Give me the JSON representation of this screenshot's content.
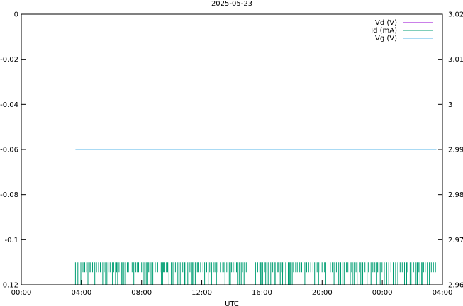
{
  "chart_data": {
    "type": "line",
    "title": "2025-05-23",
    "xlabel": "UTC",
    "ylabel": "",
    "y2label": "",
    "x_unit": "hours since 00:00 UTC",
    "xlim": [
      0,
      28
    ],
    "ylim": [
      -0.12,
      0
    ],
    "y2lim": [
      2.96,
      3.02
    ],
    "x_ticks": [
      0,
      4,
      8,
      12,
      16,
      20,
      24,
      28
    ],
    "x_tick_labels": [
      "00:00",
      "04:00",
      "08:00",
      "12:00",
      "16:00",
      "20:00",
      "00:00",
      "04:00"
    ],
    "y_ticks": [
      0,
      -0.02,
      -0.04,
      -0.06,
      -0.08,
      -0.1,
      -0.12
    ],
    "y_tick_labels": [
      "0",
      "-0.02",
      "-0.04",
      "-0.06",
      "-0.08",
      "-0.1",
      "-0.12"
    ],
    "y2_ticks": [
      3.02,
      3.01,
      3.0,
      2.99,
      2.98,
      2.97,
      2.96
    ],
    "y2_tick_labels": [
      "3.02",
      "3.01",
      "3",
      "2.99",
      "2.98",
      "2.97",
      "2.96"
    ],
    "grid": false,
    "legend_position": "top-right",
    "series": [
      {
        "name": "Vd (V)",
        "axis": "y",
        "color": "#9400d3",
        "x": [],
        "values": []
      },
      {
        "name": "Id (mA)",
        "axis": "y",
        "color": "#009e73",
        "x_range": [
          3.6,
          27.6
        ],
        "levels": [
          -0.11,
          -0.12
        ],
        "gap_ranges": [
          [
            15.1,
            15.5
          ]
        ],
        "note_style": "rapidly alternating between -0.11 and -0.12 mA"
      },
      {
        "name": "Vg (V)",
        "axis": "y2",
        "color": "#56b4e9",
        "x": [
          3.6,
          27.6
        ],
        "values": [
          2.99,
          2.99
        ]
      }
    ]
  }
}
